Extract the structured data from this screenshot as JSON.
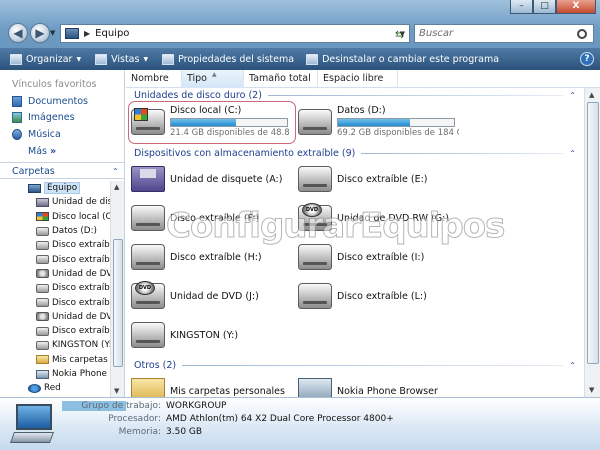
{
  "window": {
    "address": "Equipo",
    "search_placeholder": "Buscar",
    "minimize": "–",
    "maximize": "□",
    "close": "X"
  },
  "toolbar": {
    "items": [
      {
        "label": "Organizar",
        "has_dropdown": true
      },
      {
        "label": "Vistas",
        "has_dropdown": true
      },
      {
        "label": "Propiedades del sistema",
        "has_dropdown": false
      },
      {
        "label": "Desinstalar o cambiar este programa",
        "has_dropdown": false
      }
    ],
    "help": "?"
  },
  "sidebar": {
    "favorites_header": "Vínculos favoritos",
    "favorites": [
      "Documentos",
      "Imágenes",
      "Música"
    ],
    "more": "Más",
    "folders_header": "Carpetas",
    "tree": [
      {
        "label": "Equipo",
        "icon": "computer-icon",
        "selected": true
      },
      {
        "label": "Unidad de disquete",
        "icon": "floppy-icon"
      },
      {
        "label": "Disco local (C:)",
        "icon": "windows-drive-icon"
      },
      {
        "label": "Datos (D:)",
        "icon": "disk-icon"
      },
      {
        "label": "Disco extraíble (E:)",
        "icon": "disk-icon"
      },
      {
        "label": "Disco extraíble (F:)",
        "icon": "disk-icon"
      },
      {
        "label": "Unidad de DVD RW (G:)",
        "icon": "dvd-icon"
      },
      {
        "label": "Disco extraíble (H:)",
        "icon": "disk-icon"
      },
      {
        "label": "Disco extraíble (I:)",
        "icon": "disk-icon"
      },
      {
        "label": "Unidad de DVD (J:)",
        "icon": "dvd-icon"
      },
      {
        "label": "Disco extraíble (L:)",
        "icon": "disk-icon"
      },
      {
        "label": "KINGSTON (Y:)",
        "icon": "disk-icon"
      },
      {
        "label": "Mis carpetas personales",
        "icon": "folder-icon"
      },
      {
        "label": "Nokia Phone Browser",
        "icon": "phone-icon"
      },
      {
        "label": "Red",
        "icon": "network-icon"
      }
    ]
  },
  "columns": [
    "Nombre",
    "Tipo",
    "Tamaño total",
    "Espacio libre"
  ],
  "groups": {
    "hard_drives": "Unidades de disco duro (2)",
    "removable": "Dispositivos con almacenamiento extraíble (9)",
    "others": "Otros (2)"
  },
  "hard_drives": [
    {
      "name": "Disco local (C:)",
      "free_text": "21.4 GB disponibles de 48.8 GB",
      "used_fraction": 0.56,
      "icon": "windows-drive-icon"
    },
    {
      "name": "Datos (D:)",
      "free_text": "69.2 GB disponibles de 184 GB",
      "used_fraction": 0.62,
      "icon": "disk-icon"
    }
  ],
  "removable": [
    {
      "name": "Unidad de disquete (A:)",
      "icon": "floppy-icon"
    },
    {
      "name": "Disco extraíble (E:)",
      "icon": "disk-icon"
    },
    {
      "name": "Disco extraíble (F:)",
      "icon": "disk-icon"
    },
    {
      "name": "Unidad de DVD RW (G:)",
      "icon": "dvd-icon"
    },
    {
      "name": "Disco extraíble (H:)",
      "icon": "disk-icon"
    },
    {
      "name": "Disco extraíble (I:)",
      "icon": "disk-icon"
    },
    {
      "name": "Unidad de DVD (J:)",
      "icon": "dvd-icon"
    },
    {
      "name": "Disco extraíble (L:)",
      "icon": "disk-icon"
    },
    {
      "name": "KINGSTON (Y:)",
      "icon": "disk-icon"
    }
  ],
  "others": [
    {
      "name": "Mis carpetas personales",
      "icon": "folder-icon"
    },
    {
      "name": "Nokia Phone Browser",
      "icon": "phone-icon"
    }
  ],
  "watermark": "ConfigurarEquipos",
  "details": {
    "rows": [
      {
        "label": "Grupo de trabajo:",
        "value": "WORKGROUP"
      },
      {
        "label": "Procesador:",
        "value": "AMD Athlon(tm) 64 X2 Dual Core Processor 4800+"
      },
      {
        "label": "Memoria:",
        "value": "3.50 GB"
      }
    ]
  },
  "colors": {
    "toolbar": "#2b527b",
    "link": "#1a4d8f",
    "group_header": "#1e3f8c",
    "drive_bar": "#238ad1",
    "selection_outline": "#c86a7a"
  }
}
